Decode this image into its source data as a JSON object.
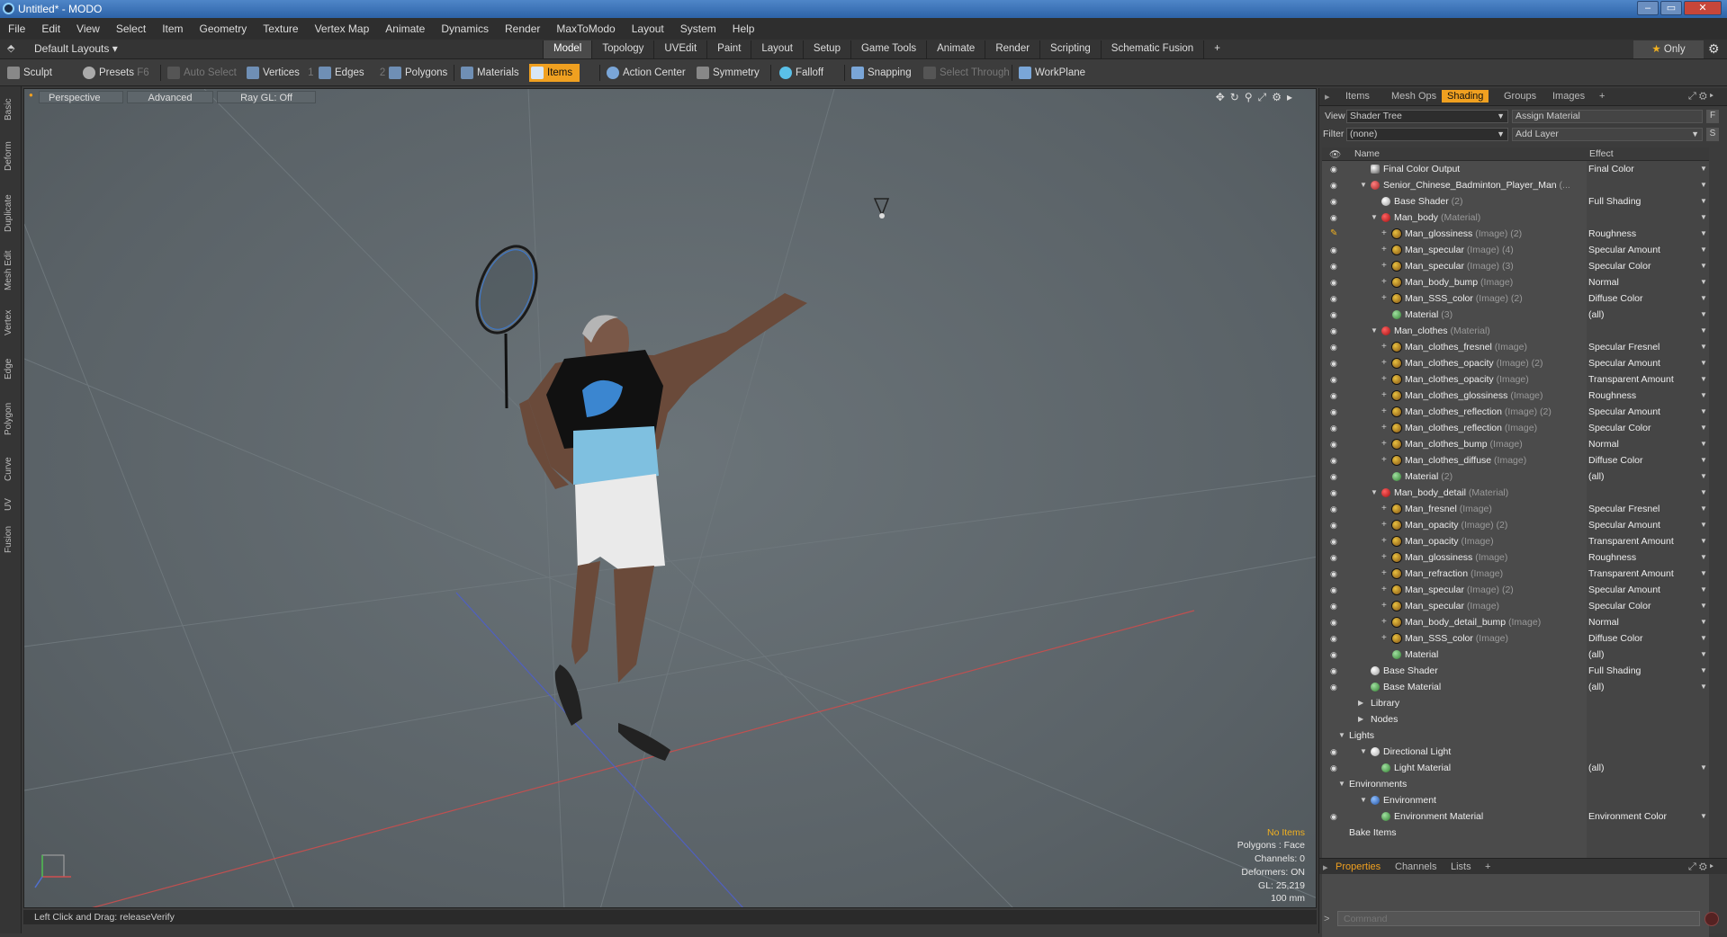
{
  "window": {
    "title": "Untitled* - MODO",
    "buttons": [
      "–",
      "▭",
      "✕"
    ]
  },
  "menu": [
    "File",
    "Edit",
    "View",
    "Select",
    "Item",
    "Geometry",
    "Texture",
    "Vertex Map",
    "Animate",
    "Dynamics",
    "Render",
    "MaxToModo",
    "Layout",
    "System",
    "Help"
  ],
  "layouts": "Default Layouts ▾",
  "tabs": [
    "Model",
    "Topology",
    "UVEdit",
    "Paint",
    "Layout",
    "Setup",
    "Game Tools",
    "Animate",
    "Render",
    "Scripting",
    "Schematic Fusion",
    "+"
  ],
  "only": "Only",
  "toolbar": {
    "sculpt": "Sculpt",
    "presets": "Presets",
    "presets_key": "F6",
    "auto_select": "Auto Select",
    "vertices": "Vertices",
    "vertices_count": "1",
    "edges": "Edges",
    "edges_count": "2",
    "polygons": "Polygons",
    "materials": "Materials",
    "items": "Items",
    "action_center": "Action Center",
    "symmetry": "Symmetry",
    "falloff": "Falloff",
    "snapping": "Snapping",
    "select_through": "Select Through",
    "workplane": "WorkPlane"
  },
  "left_tabs": [
    "Basic",
    "Deform",
    "Duplicate",
    "Mesh Edit",
    "Vertex",
    "Edge",
    "Polygon",
    "Curve",
    "UV",
    "Fusion"
  ],
  "viewport": {
    "perspective": "Perspective",
    "advanced": "Advanced",
    "raygl": "Ray GL: Off",
    "info": {
      "no_items": "No Items",
      "polygons": "Polygons : Face",
      "channels": "Channels: 0",
      "deformers": "Deformers: ON",
      "gl": "GL: 25,219",
      "scale": "100 mm"
    }
  },
  "status": "Left Click and Drag:   releaseVerify",
  "panel_tabs": [
    "Items",
    "Mesh Ops",
    "Shading",
    "Groups",
    "Images",
    "+"
  ],
  "view_label": "View",
  "view_value": "Shader Tree",
  "assign_material": "Assign Material",
  "filter_label": "Filter",
  "filter_value": "(none)",
  "add_layer": "Add Layer",
  "tree_header": {
    "name": "Name",
    "effect": "Effect"
  },
  "tree": [
    {
      "n": "Final Color Output",
      "g": "",
      "e": "Final Color",
      "ind": 2,
      "t": "out",
      "eye": true
    },
    {
      "n": "Senior_Chinese_Badminton_Player_Man",
      "g": " (...",
      "e": "",
      "ind": 2,
      "t": "grp",
      "eye": true,
      "tri": true
    },
    {
      "n": "Base Shader",
      "g": " (2)",
      "e": "Full Shading",
      "ind": 3,
      "t": "shd",
      "eye": true
    },
    {
      "n": "Man_body",
      "g": " (Material)",
      "e": "",
      "ind": 3,
      "t": "mat",
      "eye": true,
      "tri": true
    },
    {
      "n": "Man_glossiness",
      "g": " (Image) (2)",
      "e": "Roughness",
      "ind": 4,
      "t": "tex",
      "brush": true,
      "plus": true
    },
    {
      "n": "Man_specular",
      "g": " (Image) (4)",
      "e": "Specular Amount",
      "ind": 4,
      "t": "tex",
      "eye": true,
      "plus": true
    },
    {
      "n": "Man_specular",
      "g": " (Image) (3)",
      "e": "Specular Color",
      "ind": 4,
      "t": "tex",
      "eye": true,
      "plus": true
    },
    {
      "n": "Man_body_bump",
      "g": " (Image)",
      "e": "Normal",
      "ind": 4,
      "t": "tex",
      "eye": true,
      "plus": true
    },
    {
      "n": "Man_SSS_color",
      "g": " (Image) (2)",
      "e": "Diffuse Color",
      "ind": 4,
      "t": "tex",
      "eye": true,
      "plus": true
    },
    {
      "n": "Material",
      "g": " (3)",
      "e": "(all)",
      "ind": 4,
      "t": "matg",
      "eye": true
    },
    {
      "n": "Man_clothes",
      "g": " (Material)",
      "e": "",
      "ind": 3,
      "t": "mat",
      "eye": true,
      "tri": true
    },
    {
      "n": "Man_clothes_fresnel",
      "g": " (Image)",
      "e": "Specular Fresnel",
      "ind": 4,
      "t": "tex",
      "eye": true,
      "plus": true
    },
    {
      "n": "Man_clothes_opacity",
      "g": " (Image) (2)",
      "e": "Specular Amount",
      "ind": 4,
      "t": "tex",
      "eye": true,
      "plus": true
    },
    {
      "n": "Man_clothes_opacity",
      "g": " (Image)",
      "e": "Transparent Amount",
      "ind": 4,
      "t": "tex",
      "eye": true,
      "plus": true
    },
    {
      "n": "Man_clothes_glossiness",
      "g": " (Image)",
      "e": "Roughness",
      "ind": 4,
      "t": "tex",
      "eye": true,
      "plus": true
    },
    {
      "n": "Man_clothes_reflection",
      "g": " (Image) (2)",
      "e": "Specular Amount",
      "ind": 4,
      "t": "tex",
      "eye": true,
      "plus": true
    },
    {
      "n": "Man_clothes_reflection",
      "g": " (Image)",
      "e": "Specular Color",
      "ind": 4,
      "t": "tex",
      "eye": true,
      "plus": true
    },
    {
      "n": "Man_clothes_bump",
      "g": " (Image)",
      "e": "Normal",
      "ind": 4,
      "t": "tex",
      "eye": true,
      "plus": true
    },
    {
      "n": "Man_clothes_diffuse",
      "g": " (Image)",
      "e": "Diffuse Color",
      "ind": 4,
      "t": "tex",
      "eye": true,
      "plus": true
    },
    {
      "n": "Material",
      "g": " (2)",
      "e": "(all)",
      "ind": 4,
      "t": "matg",
      "eye": true
    },
    {
      "n": "Man_body_detail",
      "g": " (Material)",
      "e": "",
      "ind": 3,
      "t": "mat",
      "eye": true,
      "tri": true
    },
    {
      "n": "Man_fresnel",
      "g": " (Image)",
      "e": "Specular Fresnel",
      "ind": 4,
      "t": "tex",
      "eye": true,
      "plus": true
    },
    {
      "n": "Man_opacity",
      "g": " (Image) (2)",
      "e": "Specular Amount",
      "ind": 4,
      "t": "tex",
      "eye": true,
      "plus": true
    },
    {
      "n": "Man_opacity",
      "g": " (Image)",
      "e": "Transparent Amount",
      "ind": 4,
      "t": "tex",
      "eye": true,
      "plus": true
    },
    {
      "n": "Man_glossiness",
      "g": " (Image)",
      "e": "Roughness",
      "ind": 4,
      "t": "tex",
      "eye": true,
      "plus": true
    },
    {
      "n": "Man_refraction",
      "g": " (Image)",
      "e": "Transparent Amount",
      "ind": 4,
      "t": "tex",
      "eye": true,
      "plus": true
    },
    {
      "n": "Man_specular",
      "g": " (Image) (2)",
      "e": "Specular Amount",
      "ind": 4,
      "t": "tex",
      "eye": true,
      "plus": true
    },
    {
      "n": "Man_specular",
      "g": " (Image)",
      "e": "Specular Color",
      "ind": 4,
      "t": "tex",
      "eye": true,
      "plus": true
    },
    {
      "n": "Man_body_detail_bump",
      "g": " (Image)",
      "e": "Normal",
      "ind": 4,
      "t": "tex",
      "eye": true,
      "plus": true
    },
    {
      "n": "Man_SSS_color",
      "g": " (Image)",
      "e": "Diffuse Color",
      "ind": 4,
      "t": "tex",
      "eye": true,
      "plus": true
    },
    {
      "n": "Material",
      "g": "",
      "e": "(all)",
      "ind": 4,
      "t": "matg",
      "eye": true
    },
    {
      "n": "Base Shader",
      "g": "",
      "e": "Full Shading",
      "ind": 2,
      "t": "shd",
      "eye": true
    },
    {
      "n": "Base Material",
      "g": "",
      "e": "(all)",
      "ind": 2,
      "t": "matg",
      "eye": true
    },
    {
      "n": "Library",
      "g": "",
      "e": "",
      "ind": 1,
      "t": "",
      "tri2": true
    },
    {
      "n": "Nodes",
      "g": "",
      "e": "",
      "ind": 1,
      "t": "",
      "tri2": true
    },
    {
      "n": "Lights",
      "g": "",
      "e": "",
      "ind": 0,
      "t": "",
      "tri": true
    },
    {
      "n": "Directional Light",
      "g": "",
      "e": "",
      "ind": 2,
      "t": "lig",
      "eye": true,
      "tri": true
    },
    {
      "n": "Light Material",
      "g": "",
      "e": "(all)",
      "ind": 3,
      "t": "matg",
      "eye": true
    },
    {
      "n": "Environments",
      "g": "",
      "e": "",
      "ind": 0,
      "t": "",
      "tri": true
    },
    {
      "n": "Environment",
      "g": "",
      "e": "",
      "ind": 2,
      "t": "env",
      "tri": true
    },
    {
      "n": "Environment Material",
      "g": "",
      "e": "Environment Color",
      "ind": 3,
      "t": "matg",
      "eye": true
    },
    {
      "n": "Bake Items",
      "g": "",
      "e": "",
      "ind": 0,
      "t": ""
    }
  ],
  "props_tabs": [
    "Properties",
    "Channels",
    "Lists",
    "+"
  ],
  "command_placeholder": "Command"
}
